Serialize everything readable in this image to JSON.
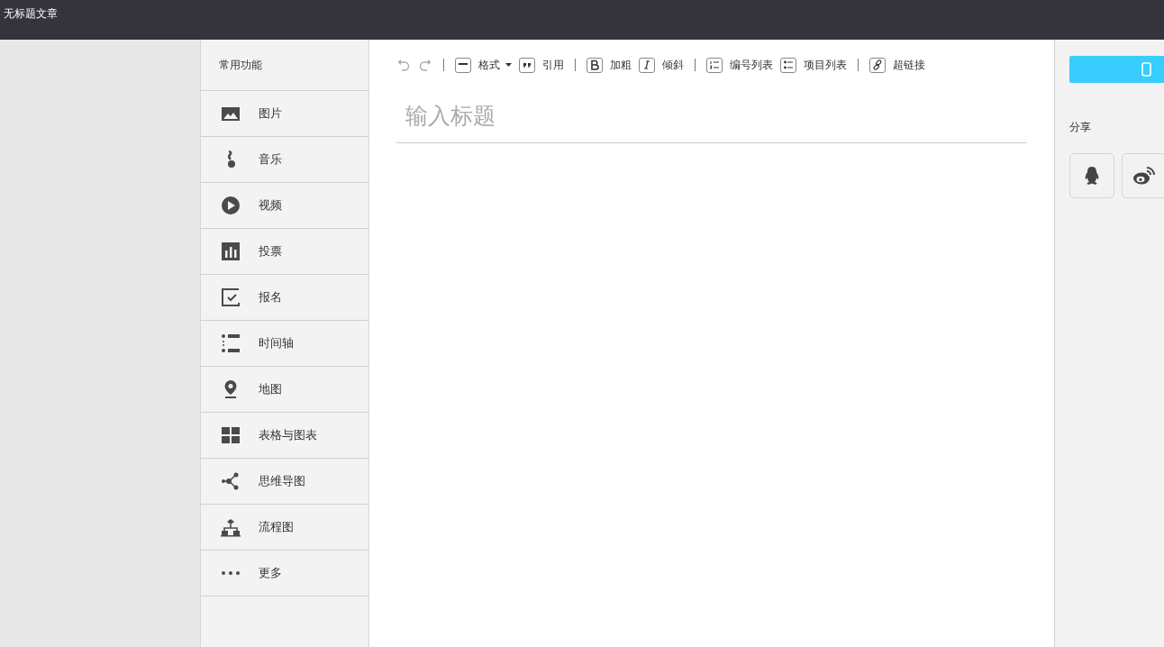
{
  "window": {
    "title": "无标题文章"
  },
  "sidebar": {
    "heading": "常用功能",
    "items": [
      {
        "kind": "image",
        "label": "图片"
      },
      {
        "kind": "music",
        "label": "音乐"
      },
      {
        "kind": "video",
        "label": "视频"
      },
      {
        "kind": "vote",
        "label": "投票"
      },
      {
        "kind": "signup",
        "label": "报名"
      },
      {
        "kind": "timeline",
        "label": "时间轴"
      },
      {
        "kind": "map",
        "label": "地图"
      },
      {
        "kind": "table",
        "label": "表格与图表"
      },
      {
        "kind": "mindmap",
        "label": "思维导图"
      },
      {
        "kind": "flowchart",
        "label": "流程图"
      },
      {
        "kind": "more",
        "label": "更多"
      }
    ]
  },
  "toolbar": {
    "groups": [
      {
        "items": [
          {
            "kind": "undo",
            "disabled": true
          },
          {
            "kind": "redo",
            "disabled": true
          }
        ]
      },
      {
        "items": [
          {
            "kind": "format",
            "label": "格式",
            "dropdown": true
          },
          {
            "kind": "quote",
            "label": "引用"
          }
        ]
      },
      {
        "items": [
          {
            "kind": "bold",
            "label": "加粗"
          },
          {
            "kind": "italic",
            "label": "倾斜"
          }
        ]
      },
      {
        "items": [
          {
            "kind": "ordered",
            "label": "编号列表"
          },
          {
            "kind": "bullet",
            "label": "项目列表"
          }
        ]
      },
      {
        "items": [
          {
            "kind": "link",
            "label": "超链接"
          }
        ]
      }
    ]
  },
  "editor": {
    "title_placeholder": "输入标题"
  },
  "right_panel": {
    "share_label": "分享",
    "share_buttons": [
      {
        "kind": "qq"
      },
      {
        "kind": "weibo"
      }
    ]
  }
}
